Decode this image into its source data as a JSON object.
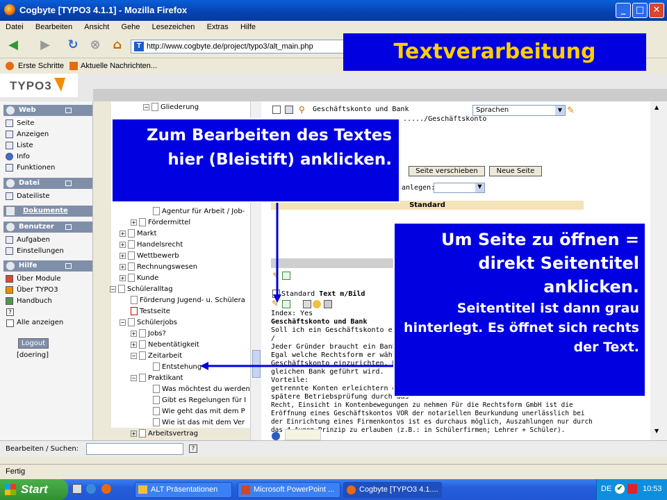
{
  "window": {
    "title": "Cogbyte [TYPO3 4.1.1] - Mozilla Firefox"
  },
  "menu": [
    "Datei",
    "Bearbeiten",
    "Ansicht",
    "Gehe",
    "Lesezeichen",
    "Extras",
    "Hilfe"
  ],
  "url": "http://www.cogbyte.de/project/typo3/alt_main.php",
  "bookmarks": [
    "Erste Schritte",
    "Aktuelle Nachrichten..."
  ],
  "typo3": {
    "logo": "TYPO3"
  },
  "modules": {
    "web": {
      "title": "Web",
      "items": [
        "Seite",
        "Anzeigen",
        "Liste",
        "Info",
        "Funktionen"
      ]
    },
    "datei": {
      "title": "Datei",
      "items": [
        "Dateiliste"
      ]
    },
    "dokumente": {
      "title": "Dokumente"
    },
    "benutzer": {
      "title": "Benutzer",
      "items": [
        "Aufgaben",
        "Einstellungen"
      ]
    },
    "hilfe": {
      "title": "Hilfe",
      "items": [
        "Über Module",
        "Über TYPO3",
        "Handbuch"
      ]
    },
    "show_all": "Alle anzeigen",
    "help_mark": "?",
    "logout": "Logout",
    "user": "[doering]"
  },
  "tree": [
    {
      "label": "Gliederung",
      "indent": 3
    },
    {
      "label": "Agentur für Arbeit / Job-",
      "indent": 4
    },
    {
      "label": "Fördermittel",
      "indent": 2,
      "pm": "+"
    },
    {
      "label": "Markt",
      "indent": 1,
      "pm": "+"
    },
    {
      "label": "Handelsrecht",
      "indent": 1,
      "pm": "+"
    },
    {
      "label": "Wettbewerb",
      "indent": 1,
      "pm": "+"
    },
    {
      "label": "Rechnungswesen",
      "indent": 1,
      "pm": "+"
    },
    {
      "label": "Kunde",
      "indent": 1,
      "pm": "+"
    },
    {
      "label": "Schüleralltag",
      "indent": 0,
      "pm": "−"
    },
    {
      "label": "Förderung Jugend- u. Schülera",
      "indent": 1
    },
    {
      "label": "Testseite",
      "indent": 1
    },
    {
      "label": "Schülerjobs",
      "indent": 1,
      "pm": "−"
    },
    {
      "label": "Jobs?",
      "indent": 2,
      "pm": "+"
    },
    {
      "label": "Nebentätigkeit",
      "indent": 2,
      "pm": "+"
    },
    {
      "label": "Zeitarbeit",
      "indent": 2,
      "pm": "−"
    },
    {
      "label": "Entstehung",
      "indent": 3
    },
    {
      "label": "Praktikant",
      "indent": 2,
      "pm": "−"
    },
    {
      "label": "Was möchtest du werden",
      "indent": 3
    },
    {
      "label": "Gibt es Regelungen für I",
      "indent": 3
    },
    {
      "label": "Wie geht das mit dem P",
      "indent": 3
    },
    {
      "label": "Wie ist das mit dem Ver",
      "indent": 3
    },
    {
      "label": "Arbeitsvertrag",
      "indent": 2
    }
  ],
  "content": {
    "page_title": "Geschäftskonto und Bank",
    "path": "...../Geschäftskonto",
    "lang_select": "Sprachen",
    "btn_move": "Seite verschieben",
    "btn_new": "Neue Seite",
    "anlegen_label": "anlegen:",
    "column_header": "Standard",
    "ce_type_prefix": "Standard",
    "ce_type": "Text m/Bild",
    "lines": [
      "Index: Yes",
      "Geschäftskonto und Bank",
      "Soll ich ein Geschäftskonto einrich",
      "/",
      "Jeder Gründer braucht ein Bankko",
      "Egal welche Rechtsform er wählt, e",
      "Geschäftskonto einzurichten. Dabe",
      "gleichen Bank geführt wird.",
      "Vorteile:",
      "getrennte Konten erleichtern das E",
      "spätere Betriebsprüfung durch das",
      "Recht, Einsicht in Kontenbewegungen zu nehmen Für die Rechtsform GmbH ist die",
      "Eröffnung eines Geschäftskontos VOR der notariellen Beurkundung unerlässlich bei",
      "der Einrichtung eines Firmenkontos ist es durchaus möglich, Auszahlungen nur durch",
      "das 4-Augen-Prinzip zu erlauben (z.B.: in Schülerfirmen; Lehrer + Schüler)."
    ]
  },
  "search": {
    "label": "Bearbeiten / Suchen:",
    "help": "?"
  },
  "status": "Fertig",
  "taskbar": {
    "start": "Start",
    "tasks": [
      "ALT Präsentationen",
      "Microsoft PowerPoint ...",
      "Cogbyte [TYPO3 4.1...."
    ],
    "lang": "DE",
    "time": "10:53"
  },
  "overlays": {
    "banner": "Textverarbeitung",
    "callout1": "Zum Bearbeiten des Textes hier (Bleistift) anklicken.",
    "callout2_main": "Um Seite zu öffnen = direkt Seitentitel anklicken.",
    "callout2_sub": "Seitentitel ist dann grau hinterlegt. Es öffnet sich rechts der Text."
  },
  "colors": {
    "callout_bg": "#0000e0",
    "banner_text": "#ffd000",
    "titlebar": "#0842b0"
  }
}
